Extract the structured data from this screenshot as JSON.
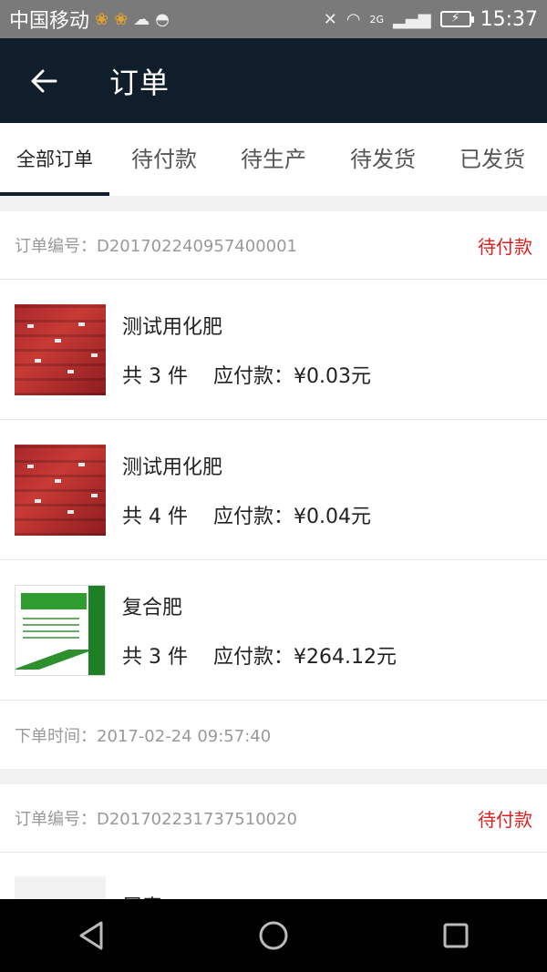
{
  "status_bar": {
    "carrier": "中国移动",
    "network": "2G",
    "time": "15:37"
  },
  "app_bar": {
    "title": "订单"
  },
  "tabs": [
    {
      "label": "全部订单",
      "active": true
    },
    {
      "label": "待付款",
      "active": false
    },
    {
      "label": "待生产",
      "active": false
    },
    {
      "label": "待发货",
      "active": false
    },
    {
      "label": "已发货",
      "active": false
    }
  ],
  "orders": [
    {
      "number": "订单编号：D201702240957400001",
      "status": "待付款",
      "items": [
        {
          "name": "测试用化肥",
          "count": "共 3 件",
          "amount": "应付款：¥0.03元"
        },
        {
          "name": "测试用化肥",
          "count": "共 4 件",
          "amount": "应付款：¥0.04元"
        },
        {
          "name": "复合肥",
          "count": "共 3 件",
          "amount": "应付款：¥264.12元"
        }
      ],
      "time": "下单时间：2017-02-24 09:57:40"
    },
    {
      "number": "订单编号：D201702231737510020",
      "status": "待付款",
      "items": [
        {
          "name": "尿素",
          "count": "",
          "amount": ""
        }
      ]
    }
  ],
  "colors": {
    "app_bar_bg": "#0f1e2a",
    "status_red": "#e01e1e"
  }
}
